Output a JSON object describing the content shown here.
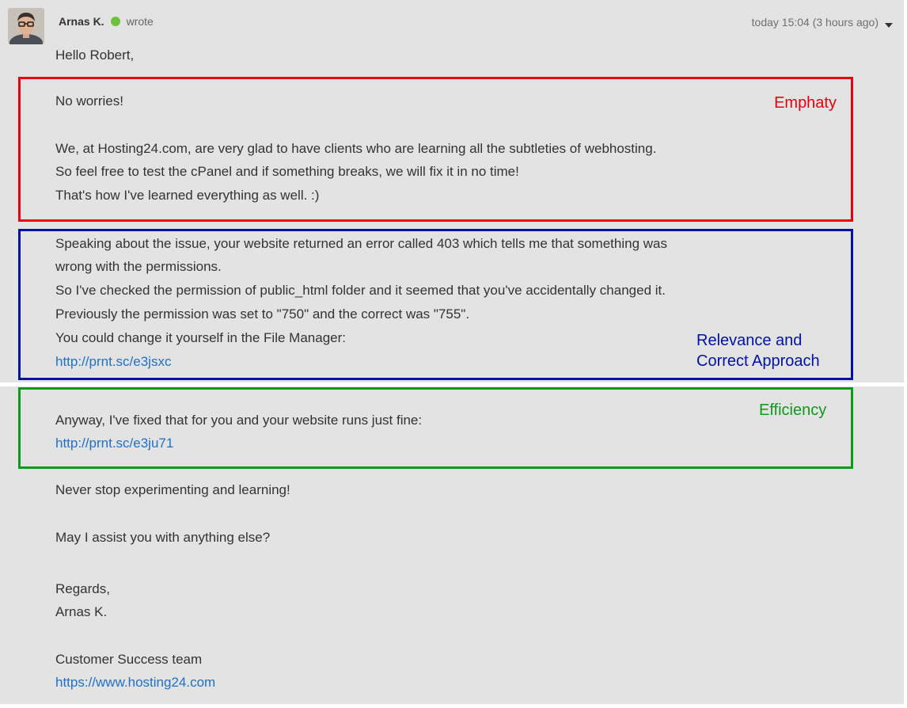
{
  "message": {
    "author": "Arnas K.",
    "author_status_color": "#6ec13b",
    "verb": "wrote",
    "timestamp": "today 15:04 (3 hours ago)",
    "avatar_icon": "user-photo"
  },
  "body": {
    "greeting": "Hello Robert,",
    "empathy": [
      "No worries!",
      "We, at Hosting24.com, are very glad to have clients who are learning all the subtleties of webhosting.",
      "So feel free to test the cPanel and if something breaks, we will fix it in no time!",
      "That's how I've learned everything as well. :)"
    ],
    "relevance": [
      "Speaking about the issue, your website returned an error called 403 which tells me that something was",
      "wrong with the permissions.",
      "So I've checked the permission of public_html folder and it seemed that you've accidentally changed it.",
      "Previously the permission was set to \"750\" and the correct was \"755\".",
      "You could change it yourself in the File Manager:"
    ],
    "relevance_link": "http://prnt.sc/e3jsxc",
    "efficiency": "Anyway, I've fixed that for you and your website runs just fine:",
    "efficiency_link": "http://prnt.sc/e3ju71",
    "closing1": "Never stop experimenting and learning!",
    "closing2": "May I assist you with anything else?",
    "regards": "Regards,",
    "signature_name": "Arnas K.",
    "team": "Customer Success team",
    "website_link": "https://www.hosting24.com"
  },
  "annotations": {
    "empathy_label": "Emphaty",
    "relevance_label_line1": "Relevance and",
    "relevance_label_line2": "Correct Approach",
    "efficiency_label": "Efficiency",
    "colors": {
      "red": "#e8000f",
      "blue": "#0012a8",
      "green": "#0d9a1a",
      "link": "#1e70c8"
    }
  }
}
